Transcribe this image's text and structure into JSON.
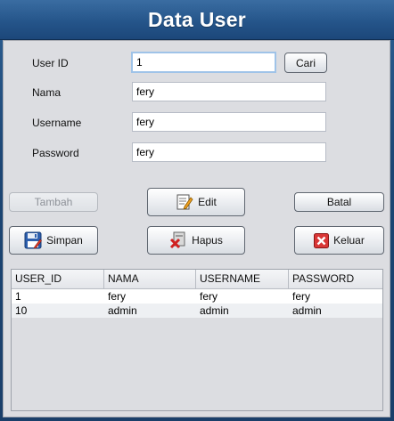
{
  "window": {
    "title": "Data User"
  },
  "form": {
    "user_id_label": "User ID",
    "user_id_value": "1",
    "nama_label": "Nama",
    "nama_value": "fery",
    "username_label": "Username",
    "username_value": "fery",
    "password_label": "Password",
    "password_value": "fery"
  },
  "buttons": {
    "cari": "Cari",
    "tambah": "Tambah",
    "edit": "Edit",
    "batal": "Batal",
    "simpan": "Simpan",
    "hapus": "Hapus",
    "keluar": "Keluar"
  },
  "table": {
    "headers": [
      "USER_ID",
      "NAMA",
      "USERNAME",
      "PASSWORD"
    ],
    "rows": [
      [
        "1",
        "fery",
        "fery",
        "fery"
      ],
      [
        "10",
        "admin",
        "admin",
        "admin"
      ]
    ]
  },
  "colors": {
    "title_bar": "#25558a",
    "panel_bg": "#dcdde1",
    "keluar_icon": "#d93636"
  }
}
